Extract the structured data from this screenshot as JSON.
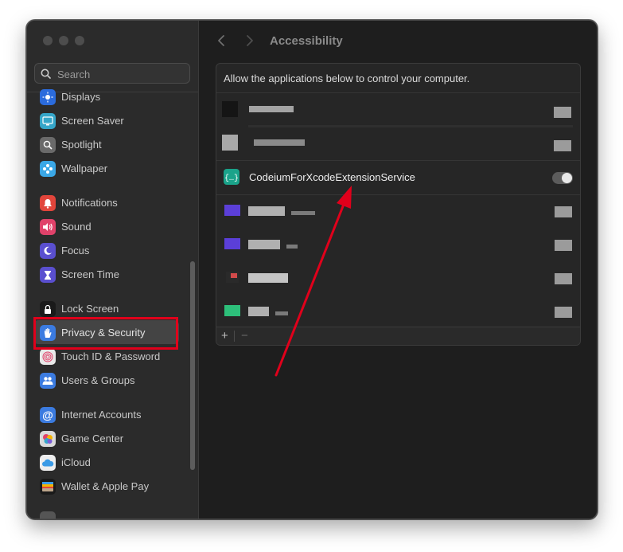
{
  "search": {
    "placeholder": "Search"
  },
  "sidebar": {
    "items": [
      {
        "label": "Displays",
        "icon": "displays-icon",
        "color": "#2b6bdc"
      },
      {
        "label": "Screen Saver",
        "icon": "screen-saver-icon",
        "color": "#35a6c9"
      },
      {
        "label": "Spotlight",
        "icon": "spotlight-icon",
        "color": "#6a6a6a"
      },
      {
        "label": "Wallpaper",
        "icon": "wallpaper-icon",
        "color": "#3aa7e6"
      },
      {
        "label": "Notifications",
        "icon": "notifications-icon",
        "color": "#e1453b"
      },
      {
        "label": "Sound",
        "icon": "sound-icon",
        "color": "#e0426a"
      },
      {
        "label": "Focus",
        "icon": "focus-icon",
        "color": "#5a4fcf"
      },
      {
        "label": "Screen Time",
        "icon": "screen-time-icon",
        "color": "#5a4fcf"
      },
      {
        "label": "Lock Screen",
        "icon": "lock-screen-icon",
        "color": "#1a1a1a"
      },
      {
        "label": "Privacy & Security",
        "icon": "privacy-hand-icon",
        "color": "#3b7be0"
      },
      {
        "label": "Touch ID & Password",
        "icon": "touch-id-icon",
        "color": "#e9e9e9"
      },
      {
        "label": "Users & Groups",
        "icon": "users-groups-icon",
        "color": "#3b7be0"
      },
      {
        "label": "Internet Accounts",
        "icon": "internet-accounts-icon",
        "color": "#3b7be0"
      },
      {
        "label": "Game Center",
        "icon": "game-center-icon",
        "color": "#d9d9d9"
      },
      {
        "label": "iCloud",
        "icon": "icloud-icon",
        "color": "#eeeeee"
      },
      {
        "label": "Wallet & Apple Pay",
        "icon": "wallet-icon",
        "color": "#1a1a1a"
      }
    ],
    "selected": "Privacy & Security"
  },
  "main": {
    "title": "Accessibility",
    "panel_header": "Allow the applications below to control your computer.",
    "app_label": "CodeiumForXcodeExtensionService",
    "app_icon": "codeium-braces-icon",
    "app_icon_color": "#1aa38a",
    "add_label": "+",
    "remove_label": "−"
  },
  "annotation": {
    "color": "#e0001b"
  }
}
